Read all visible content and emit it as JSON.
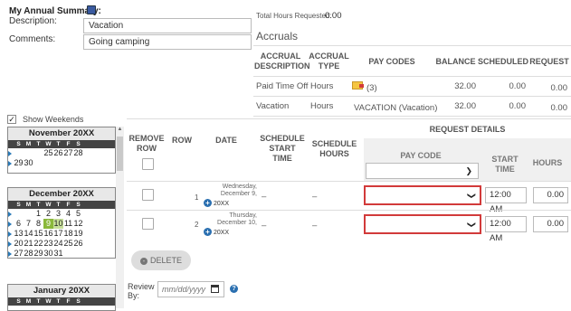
{
  "summary": {
    "title": "My Annual Summary:",
    "description_label": "Description:",
    "description_value": "Vacation",
    "comments_label": "Comments:",
    "comments_value": "Going camping"
  },
  "total_hours": {
    "label": "Total Hours Requested:",
    "value": "0.00"
  },
  "accruals": {
    "title": "Accruals",
    "headers": [
      "ACCRUAL DESCRIPTION",
      "ACCRUAL TYPE",
      "PAY CODES",
      "BALANCE",
      "SCHEDULED",
      "REQUEST"
    ],
    "rows": [
      {
        "description": "Paid Time Off",
        "type": "Hours",
        "pay_code": "(3)",
        "balance": "32.00",
        "scheduled": "0.00",
        "request": "0.00"
      },
      {
        "description": "Vacation",
        "type": "Hours",
        "pay_code": "VACATION (Vacation)",
        "balance": "32.00",
        "scheduled": "0.00",
        "request": "0.00"
      }
    ]
  },
  "show_weekends": {
    "label": "Show Weekends",
    "checked": true
  },
  "calendars": {
    "dow": [
      "S",
      "M",
      "T",
      "W",
      "T",
      "F",
      "S"
    ],
    "november": {
      "title": "November 20XX",
      "rows": [
        [
          "",
          "",
          "",
          "25",
          "26",
          "27",
          "28"
        ],
        [
          "29",
          "30",
          "",
          "",
          "",
          "",
          ""
        ]
      ]
    },
    "december": {
      "title": "December 20XX",
      "rows": [
        [
          "",
          "",
          "1",
          "2",
          "3",
          "4",
          "5"
        ],
        [
          "6",
          "7",
          "8",
          "9",
          "10",
          "11",
          "12"
        ],
        [
          "13",
          "14",
          "15",
          "16",
          "17",
          "18",
          "19"
        ],
        [
          "20",
          "21",
          "22",
          "23",
          "24",
          "25",
          "26"
        ],
        [
          "27",
          "28",
          "29",
          "30",
          "31",
          "",
          ""
        ]
      ]
    },
    "january": {
      "title": "January 20XX"
    }
  },
  "request_table": {
    "headers": {
      "remove_row": "REMOVE ROW",
      "row": "ROW",
      "date": "DATE",
      "schedule_start": "SCHEDULE START TIME",
      "schedule_hours": "SCHEDULE HOURS",
      "request_details": "REQUEST DETAILS",
      "pay_code": "PAY CODE",
      "start_time": "START TIME",
      "hours": "HOURS"
    },
    "rows": [
      {
        "row": "1",
        "date_line1": "Wednesday,",
        "date_line2": "December 9,",
        "date_line3": "20XX",
        "start": "–",
        "hours": "–",
        "req_start": "12:00 AM",
        "req_hours": "0.00"
      },
      {
        "row": "2",
        "date_line1": "Thursday,",
        "date_line2": "December 10,",
        "date_line3": "20XX",
        "start": "–",
        "hours": "–",
        "req_start": "12:00 AM",
        "req_hours": "0.00"
      }
    ]
  },
  "delete_button": "DELETE",
  "review_by": {
    "label": "Review By:",
    "placeholder": "mm/dd/yyyy"
  }
}
